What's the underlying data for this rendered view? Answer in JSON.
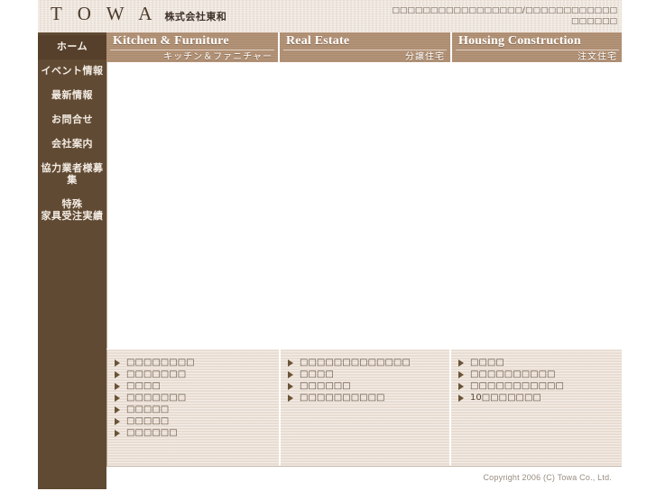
{
  "site": {
    "logo_mark": "T O W A",
    "logo_sub": "株式会社東和",
    "header_note_line1": "□□□□□□□□□□□□□□□□□/□□□□□□□□□□□□",
    "header_note_line2": "□□□□□□"
  },
  "colors": {
    "sidebar_bg": "#614a33",
    "sidebar_active": "#56402b",
    "section_bar": "#b08e71",
    "panel_bg": "#ece2d8",
    "header_bg": "#ece2d8",
    "bullet": "#6b5336",
    "link_text": "#5c4a3a",
    "copyright_text": "#9a8d80"
  },
  "sidebar": {
    "items": [
      {
        "label": "ホーム",
        "active": true
      },
      {
        "label": "イベント情報",
        "active": false
      },
      {
        "label": "最新情報",
        "active": false
      },
      {
        "label": "お問合せ",
        "active": false
      },
      {
        "label": "会社案内",
        "active": false
      },
      {
        "label": "協力業者様募集",
        "active": false
      },
      {
        "label": "特殊\n家具受注実績",
        "active": false,
        "line1": "特殊",
        "line2": "家具受注実績"
      }
    ]
  },
  "sections": [
    {
      "en": "Kitchen & Furniture",
      "ja": "キッチン＆ファニチャー"
    },
    {
      "en": "Real Estate",
      "ja": "分譲住宅"
    },
    {
      "en": "Housing Construction",
      "ja": "注文住宅"
    }
  ],
  "link_columns": [
    {
      "name": "kitchen-furniture-links",
      "items": [
        "□□□□□□□□",
        "□□□□□□□",
        "□□□□",
        "□□□□□□□",
        "□□□□□",
        "□□□□□",
        "□□□□□□"
      ]
    },
    {
      "name": "real-estate-links",
      "items": [
        "□□□□□□□□□□□□□",
        "□□□□",
        "□□□□□□",
        "□□□□□□□□□□"
      ]
    },
    {
      "name": "housing-construction-links",
      "items": [
        "□□□□",
        "□□□□□□□□□□",
        "□□□□□□□□□□□",
        "10□□□□□□□"
      ]
    }
  ],
  "footer": {
    "copyright": "Copyright 2006 (C) Towa Co., Ltd."
  }
}
